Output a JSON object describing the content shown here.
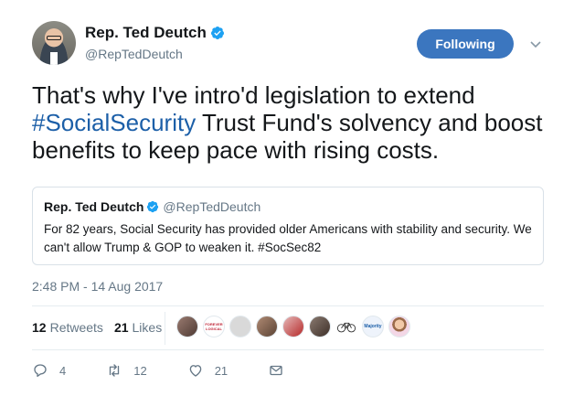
{
  "author": {
    "display_name": "Rep. Ted Deutch",
    "handle": "@RepTedDeutch",
    "verified": true
  },
  "follow_button": {
    "label": "Following"
  },
  "tweet": {
    "text_before": "That's why I've intro'd legislation to extend ",
    "hashtag": "#SocialSecurity",
    "text_after": " Trust Fund's solvency and boost benefits to keep pace with rising costs."
  },
  "quoted_tweet": {
    "display_name": "Rep. Ted Deutch",
    "handle": "@RepTedDeutch",
    "text": "For 82 years, Social Security has provided older Americans with stability and security. We can't allow Trump & GOP to weaken it. #SocSec82"
  },
  "timestamp": "2:48 PM - 14 Aug 2017",
  "stats": {
    "retweets_count": "12",
    "retweets_label": "Retweets",
    "likes_count": "21",
    "likes_label": "Likes"
  },
  "liker_avatars": [
    {
      "icon": "user-avatar-icon",
      "color": "#7a5a52"
    },
    {
      "icon": "forever-logical-badge-icon",
      "color": "#c0283a",
      "label": "FOREVER LOGICAL"
    },
    {
      "icon": "user-avatar-icon",
      "color": "#d9d9d9"
    },
    {
      "icon": "user-avatar-icon",
      "color": "#8a6e5d"
    },
    {
      "icon": "user-avatar-icon",
      "color": "#c23a3a"
    },
    {
      "icon": "user-avatar-icon",
      "color": "#5a4a42"
    },
    {
      "icon": "bicycle-icon",
      "color": "#ffffff"
    },
    {
      "icon": "majority-logo-icon",
      "color": "#ffffff",
      "label": "Majority"
    },
    {
      "icon": "user-avatar-icon",
      "color": "#f4d7e6"
    }
  ],
  "actions": {
    "reply_count": "4",
    "retweet_count": "12",
    "like_count": "21"
  },
  "colors": {
    "accent": "#3b76bf",
    "hashtag": "#1c5fa8",
    "muted": "#657786",
    "verified": "#1da1f2"
  }
}
